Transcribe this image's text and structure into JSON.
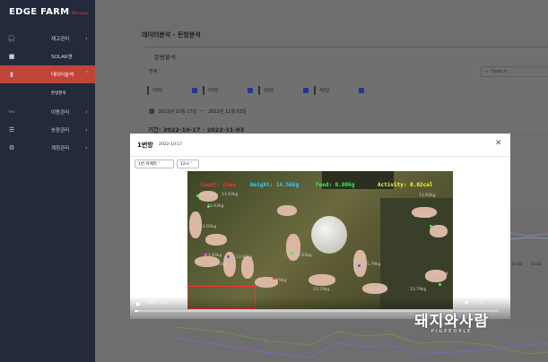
{
  "logo": {
    "text": "EDGE FARM",
    "sub": "Manager"
  },
  "nav": [
    {
      "label": "재고관리",
      "icon": "headset-icon",
      "chevron": "›"
    },
    {
      "label": "SOLAR영",
      "icon": "video-icon",
      "chevron": ""
    },
    {
      "label": "데이터분석",
      "icon": "chart-icon",
      "chevron": "˅",
      "active": true
    },
    {
      "label": "이동관리",
      "icon": "chart-line-icon",
      "chevron": "›"
    },
    {
      "label": "농장관리",
      "icon": "sliders-icon",
      "chevron": "›"
    },
    {
      "label": "계정관리",
      "icon": "gear-icon",
      "chevron": "›"
    }
  ],
  "sub_item": "돈방분석",
  "breadcrumb": "데이터분석 - 돈방분석",
  "card_title": "돈방분석",
  "select_all": "전체",
  "search_placeholder": "Search",
  "checkboxes": [
    "1번방",
    "2번방",
    "3번방",
    "4번방"
  ],
  "date_range": {
    "from": "2022년 10월 17일",
    "sep": "—",
    "to": "2022년 11월 03일"
  },
  "period": "기간: 2022-10-17 - 2022-11-03",
  "modal": {
    "title": "1번방",
    "date": "2022-10-17",
    "close": "✕",
    "camera_select": "1번 카메라",
    "hour_select": "12시"
  },
  "video": {
    "overlay": {
      "count": "Count: 25ea",
      "weight": "Weight: 14.56kg",
      "feed": "Feed: 0.00kg",
      "activity": "Activity: 0.02cal"
    },
    "weights": [
      "13.93kg",
      "13.93kg",
      "13.93kg",
      "13.93kg",
      "13.93kg",
      "13.93kg",
      "13.93kg",
      "13.79kg",
      "13.79kg",
      "13.93kg",
      "15.79kg",
      "13.79kg",
      "5.79kg",
      "13.93kg",
      "13.93kg",
      "13.93kg"
    ],
    "current_time": "0:01 / 4:59",
    "progress": 0.01
  },
  "right_axis": [
    "11-03",
    "11-02"
  ],
  "watermark": {
    "main": "돼지와사람",
    "sub": "PIGPEOPLE"
  },
  "colors": {
    "sidebar": "#232a3b",
    "accent": "#c1443a",
    "count": "#ff3030",
    "weight": "#33ccff",
    "feed": "#22ff44",
    "activity": "#ffff33"
  }
}
